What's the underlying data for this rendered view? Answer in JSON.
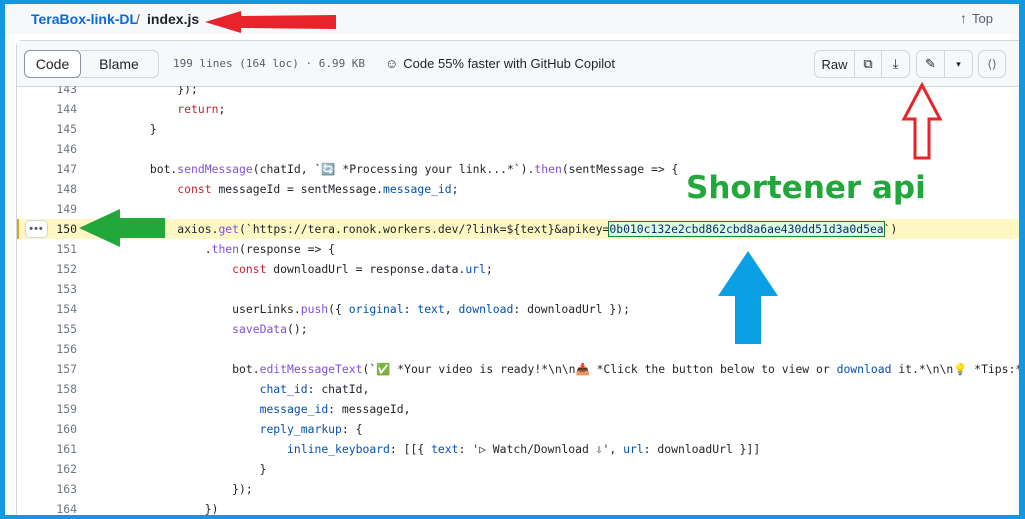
{
  "breadcrumb": {
    "repo": "TeraBox-link-DL",
    "separator": "/",
    "file": "index.js"
  },
  "top_link": {
    "arrow": "↑",
    "label": "Top"
  },
  "file_header": {
    "tabs": [
      "Code",
      "Blame"
    ],
    "info": "199 lines (164 loc) · 6.99 KB",
    "copilot": "Code 55% faster with GitHub Copilot",
    "copilot_icon": "☺",
    "raw_label": "Raw",
    "copy_icon": "⧉",
    "download_icon": "⤓",
    "edit_icon": "✎",
    "caret_icon": "▾",
    "symbols_icon": "⟨⟩"
  },
  "code_lines": [
    {
      "n": "143",
      "code": "            });"
    },
    {
      "n": "144",
      "code": "            return;"
    },
    {
      "n": "145",
      "code": "        }"
    },
    {
      "n": "146",
      "code": ""
    },
    {
      "n": "147",
      "code": "        bot.sendMessage(chatId, `🔄 *Processing your link...*`).then(sentMessage => {"
    },
    {
      "n": "148",
      "code": "            const messageId = sentMessage.message_id;"
    },
    {
      "n": "149",
      "code": ""
    },
    {
      "n": "150",
      "code": "            axios.get(`https://tera.ronok.workers.dev/?link=${text}&apikey=0b010c132e2cbd862cbd8a6ae430dd51d3a0d5ea`)"
    },
    {
      "n": "151",
      "code": "                .then(response => {"
    },
    {
      "n": "152",
      "code": "                    const downloadUrl = response.data.url;"
    },
    {
      "n": "153",
      "code": ""
    },
    {
      "n": "154",
      "code": "                    userLinks.push({ original: text, download: downloadUrl });"
    },
    {
      "n": "155",
      "code": "                    saveData();"
    },
    {
      "n": "156",
      "code": ""
    },
    {
      "n": "157",
      "code": "                    bot.editMessageText(`✅ *Your video is ready!*\\n\\n📥 *Click the button below to view or download it.*\\n\\n💡 *Tips:*\\n`"
    },
    {
      "n": "158",
      "code": "                        chat_id: chatId,"
    },
    {
      "n": "159",
      "code": "                        message_id: messageId,"
    },
    {
      "n": "160",
      "code": "                        reply_markup: {"
    },
    {
      "n": "161",
      "code": "                            inline_keyboard: [[{ text: '▷ Watch/Download ⇩', url: downloadUrl }]]"
    },
    {
      "n": "162",
      "code": "                        }"
    },
    {
      "n": "163",
      "code": "                    });"
    },
    {
      "n": "164",
      "code": "                })"
    }
  ],
  "highlighted_line": "150",
  "api_key": "0b010c132e2cbd862cbd8a6ae430dd51d3a0d5ea",
  "line_menu_icon": "•••",
  "annotation_text": "Shortener api",
  "colors": {
    "frame": "#1297e0",
    "red_arrow": "#e8232b",
    "green": "#22a83a",
    "blue_arrow": "#0aa0e6"
  }
}
